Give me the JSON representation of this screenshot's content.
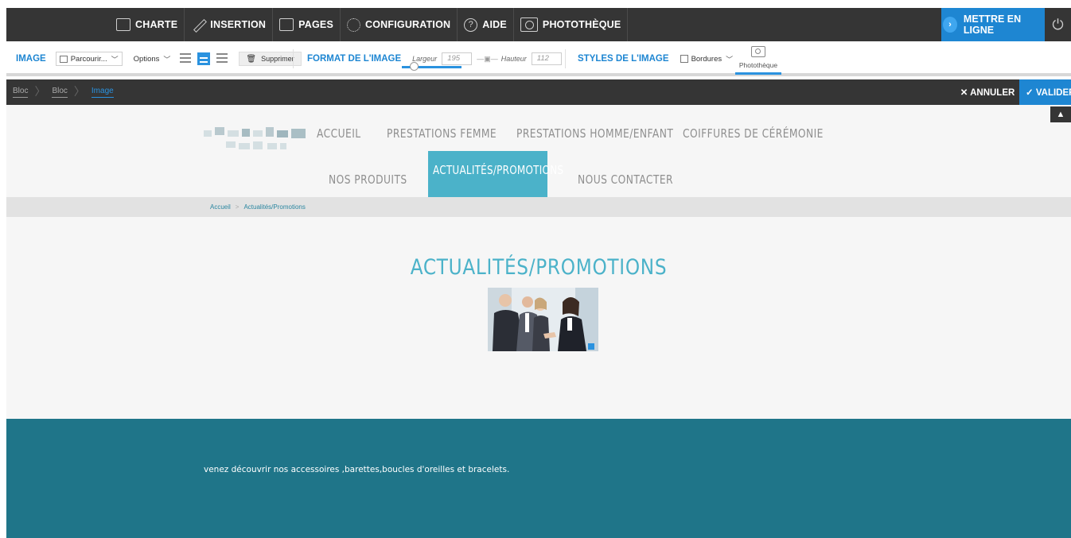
{
  "topbar": {
    "menu": [
      {
        "label": "CHARTE",
        "icon": "layout-icon"
      },
      {
        "label": "INSERTION",
        "icon": "pencil-icon"
      },
      {
        "label": "PAGES",
        "icon": "pages-icon"
      },
      {
        "label": "CONFIGURATION",
        "icon": "gear-icon"
      },
      {
        "label": "AIDE",
        "icon": "help-icon"
      },
      {
        "label": "PHOTOTHÈQUE",
        "icon": "camera-icon"
      }
    ],
    "publish_label": "METTRE EN LIGNE",
    "help_glyph": "?"
  },
  "toolbar": {
    "image_title": "IMAGE",
    "browse_label": "Parcourir...",
    "options_label": "Options",
    "delete_label": "Supprimer",
    "format_title": "FORMAT DE L'IMAGE",
    "width_label": "Largeur",
    "width_value": "195",
    "height_label": "Hauteur",
    "height_value": "112",
    "styles_title": "STYLES DE L'IMAGE",
    "borders_label": "Bordures",
    "phototheque_label": "Photothèque"
  },
  "editbar": {
    "crumbs": [
      "Bloc",
      "Bloc",
      "Image"
    ],
    "cancel_label": "✕ ANNULER",
    "validate_label": "✓ VALIDER"
  },
  "site": {
    "nav_row1": [
      "ACCUEIL",
      "PRESTATIONS FEMME",
      "PRESTATIONS HOMME/ENFANT",
      "COIFFURES DE CÉRÉMONIE"
    ],
    "nav_row2": [
      "NOS PRODUITS",
      "ACTUALITÉS/PROMOTIONS",
      "NOUS CONTACTER"
    ],
    "breadcrumb": [
      "Accueil",
      "Actualités/Promotions"
    ],
    "page_title": "ACTUALITÉS/PROMOTIONS",
    "footer_text": "venez découvrir nos accessoires ,barettes,boucles d'oreilles et bracelets.",
    "accent_color": "#4bb2c9",
    "footer_color": "#1f7589"
  },
  "colors": {
    "brand_blue": "#1e86d2",
    "dark_bar": "#353535"
  }
}
